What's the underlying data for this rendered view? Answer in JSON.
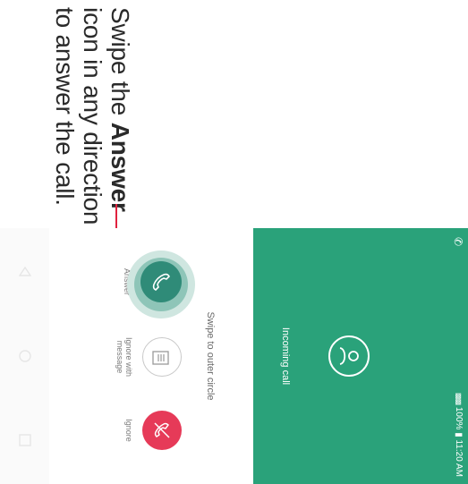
{
  "caption": {
    "line1_prefix": "Swipe the ",
    "line1_bold": "Answer",
    "line2": "icon in any direction",
    "line3": "to answer the call."
  },
  "status_bar": {
    "battery": "100%",
    "time": "11:20 AM"
  },
  "call": {
    "status": "Incoming call"
  },
  "hint": "Swipe to outer circle",
  "actions": {
    "answer": "Answer",
    "reply_line1": "Ignore with",
    "reply_line2": "message",
    "ignore": "Ignore"
  },
  "colors": {
    "header_green": "#2aa27a",
    "answer_teal": "#2f8b78",
    "ignore_red": "#e63a58",
    "leader_red": "#e0223f"
  },
  "icons": [
    "phone-icon",
    "signal-icon",
    "battery-icon",
    "contact-avatar-icon",
    "answer-phone-icon",
    "message-icon",
    "decline-phone-icon",
    "back-icon",
    "home-icon",
    "recent-apps-icon"
  ]
}
